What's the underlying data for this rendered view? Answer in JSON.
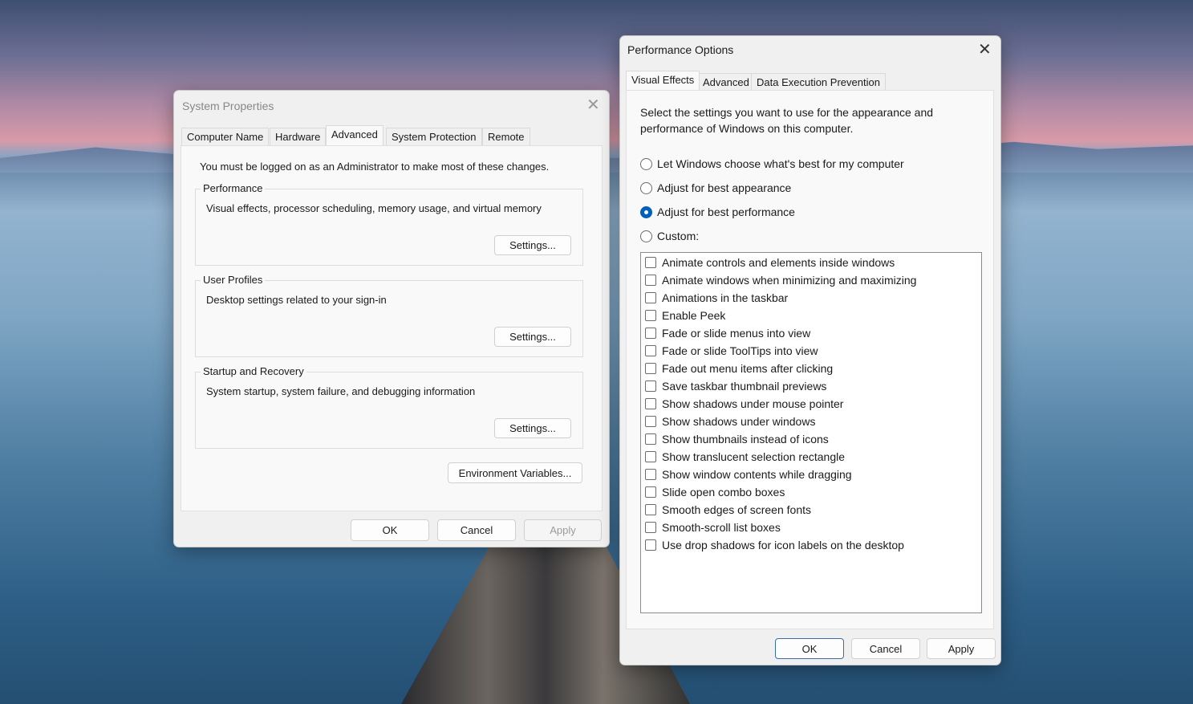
{
  "system_properties": {
    "title": "System Properties",
    "tabs": [
      "Computer Name",
      "Hardware",
      "Advanced",
      "System Protection",
      "Remote"
    ],
    "active_tab": "Advanced",
    "admin_notice": "You must be logged on as an Administrator to make most of these changes.",
    "groups": [
      {
        "label": "Performance",
        "description": "Visual effects, processor scheduling, memory usage, and virtual memory",
        "button": "Settings..."
      },
      {
        "label": "User Profiles",
        "description": "Desktop settings related to your sign-in",
        "button": "Settings..."
      },
      {
        "label": "Startup and Recovery",
        "description": "System startup, system failure, and debugging information",
        "button": "Settings..."
      }
    ],
    "env_button": "Environment Variables...",
    "ok": "OK",
    "cancel": "Cancel",
    "apply": "Apply"
  },
  "performance_options": {
    "title": "Performance Options",
    "tabs": [
      "Visual Effects",
      "Advanced",
      "Data Execution Prevention"
    ],
    "active_tab": "Visual Effects",
    "intro_line1": "Select the settings you want to use for the appearance and",
    "intro_line2": "performance of Windows on this computer.",
    "radios": [
      {
        "label": "Let Windows choose what's best for my computer",
        "checked": false
      },
      {
        "label": "Adjust for best appearance",
        "checked": false
      },
      {
        "label": "Adjust for best performance",
        "checked": true
      },
      {
        "label": "Custom:",
        "checked": false
      }
    ],
    "effects": [
      {
        "label": "Animate controls and elements inside windows",
        "checked": false
      },
      {
        "label": "Animate windows when minimizing and maximizing",
        "checked": false
      },
      {
        "label": "Animations in the taskbar",
        "checked": false
      },
      {
        "label": "Enable Peek",
        "checked": false
      },
      {
        "label": "Fade or slide menus into view",
        "checked": false
      },
      {
        "label": "Fade or slide ToolTips into view",
        "checked": false
      },
      {
        "label": "Fade out menu items after clicking",
        "checked": false
      },
      {
        "label": "Save taskbar thumbnail previews",
        "checked": false
      },
      {
        "label": "Show shadows under mouse pointer",
        "checked": false
      },
      {
        "label": "Show shadows under windows",
        "checked": false
      },
      {
        "label": "Show thumbnails instead of icons",
        "checked": false
      },
      {
        "label": "Show translucent selection rectangle",
        "checked": false
      },
      {
        "label": "Show window contents while dragging",
        "checked": false
      },
      {
        "label": "Slide open combo boxes",
        "checked": false
      },
      {
        "label": "Smooth edges of screen fonts",
        "checked": false
      },
      {
        "label": "Smooth-scroll list boxes",
        "checked": false
      },
      {
        "label": "Use drop shadows for icon labels on the desktop",
        "checked": false
      }
    ],
    "ok": "OK",
    "cancel": "Cancel",
    "apply": "Apply",
    "accent_color": "#005fb8"
  }
}
